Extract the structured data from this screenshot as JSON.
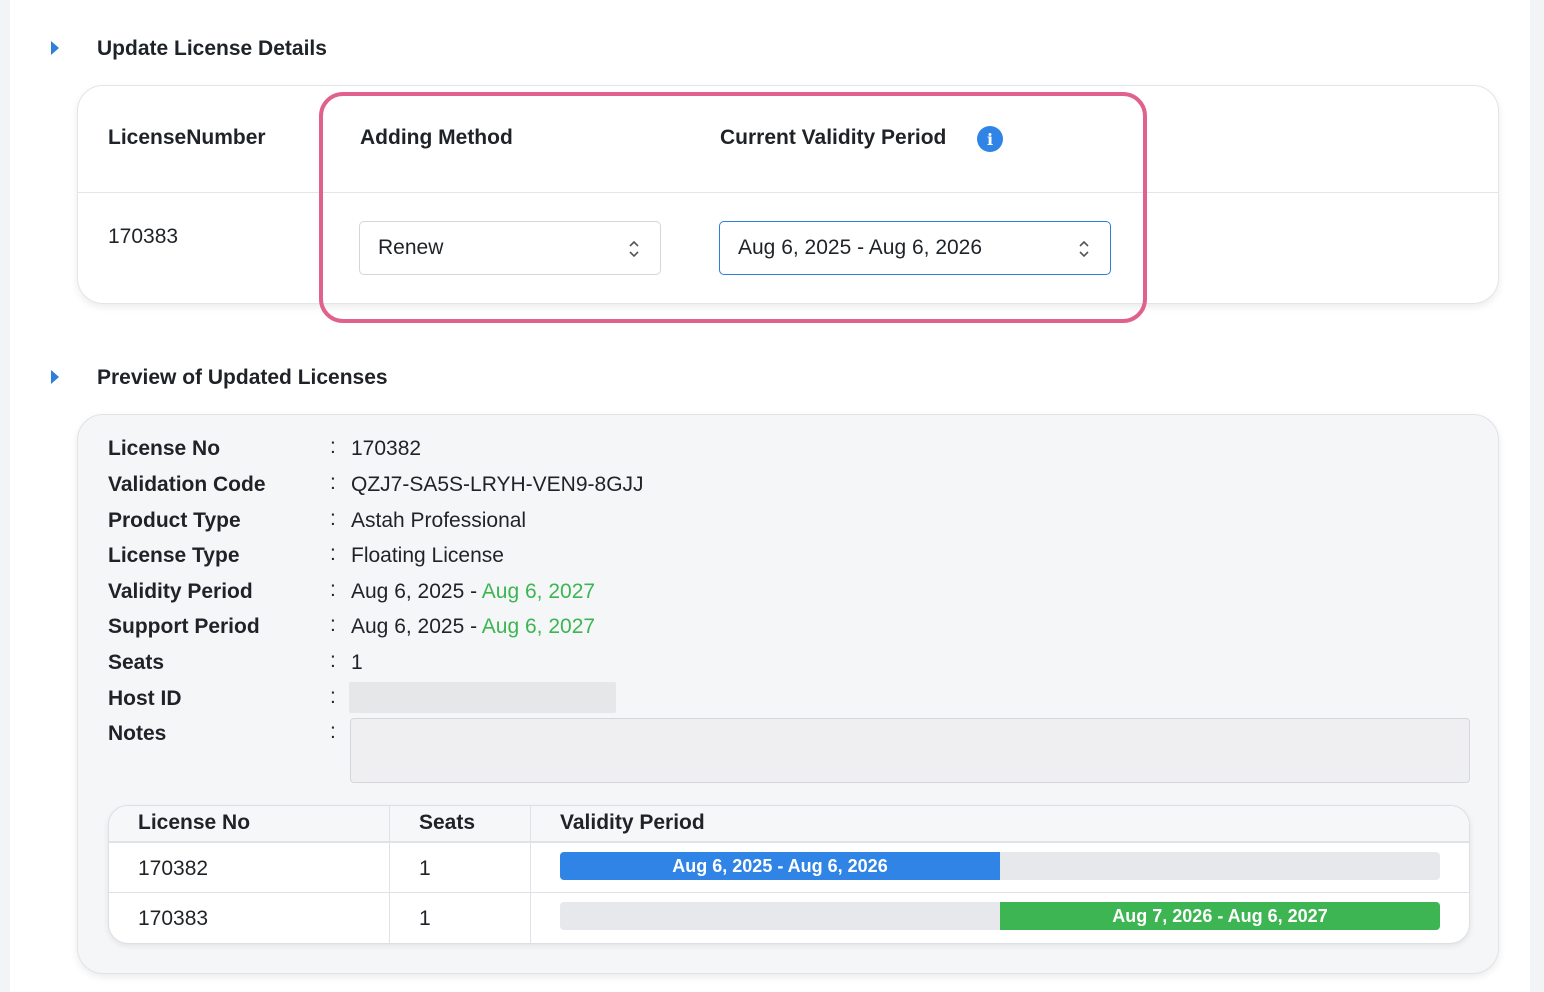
{
  "colors": {
    "accent": "#2f7fd8",
    "highlight": "#e0608e",
    "success": "#3db552",
    "bar_blue": "#2f84e6",
    "bar_green": "#3db552"
  },
  "update_section": {
    "title": "Update License Details",
    "columns": {
      "license_number": "LicenseNumber",
      "adding_method": "Adding Method",
      "current_validity": "Current Validity Period"
    },
    "info_icon": "info-icon",
    "row": {
      "license_number": "170383",
      "adding_method": "Renew",
      "validity_period": "Aug 6, 2025 - Aug 6, 2026"
    }
  },
  "preview_section": {
    "title": "Preview of Updated Licenses",
    "details": {
      "license_no": {
        "label": "License No",
        "value": "170382"
      },
      "validation_code": {
        "label": "Validation Code",
        "value": "QZJ7-SA5S-LRYH-VEN9-8GJJ"
      },
      "product_type": {
        "label": "Product Type",
        "value": "Astah Professional"
      },
      "license_type": {
        "label": "License Type",
        "value": "Floating License"
      },
      "validity_period": {
        "label": "Validity Period",
        "start": "Aug 6, 2025",
        "separator": "-",
        "end": "Aug 6, 2027"
      },
      "support_period": {
        "label": "Support Period",
        "start": "Aug 6, 2025",
        "separator": "-",
        "end": "Aug 6, 2027"
      },
      "seats": {
        "label": "Seats",
        "value": "1"
      },
      "host_id": {
        "label": "Host ID",
        "value": ""
      },
      "notes": {
        "label": "Notes",
        "value": ""
      },
      "colon": ":"
    },
    "table": {
      "headers": {
        "license_no": "License No",
        "seats": "Seats",
        "validity_period": "Validity Period"
      },
      "rows": [
        {
          "license_no": "170382",
          "seats": "1",
          "period": "Aug 6, 2025 - Aug 6, 2026",
          "bar_start": 0.0,
          "bar_end": 0.5
        },
        {
          "license_no": "170383",
          "seats": "1",
          "period": "Aug 7, 2026 - Aug 6, 2027",
          "bar_start": 0.5,
          "bar_end": 1.0
        }
      ]
    }
  }
}
